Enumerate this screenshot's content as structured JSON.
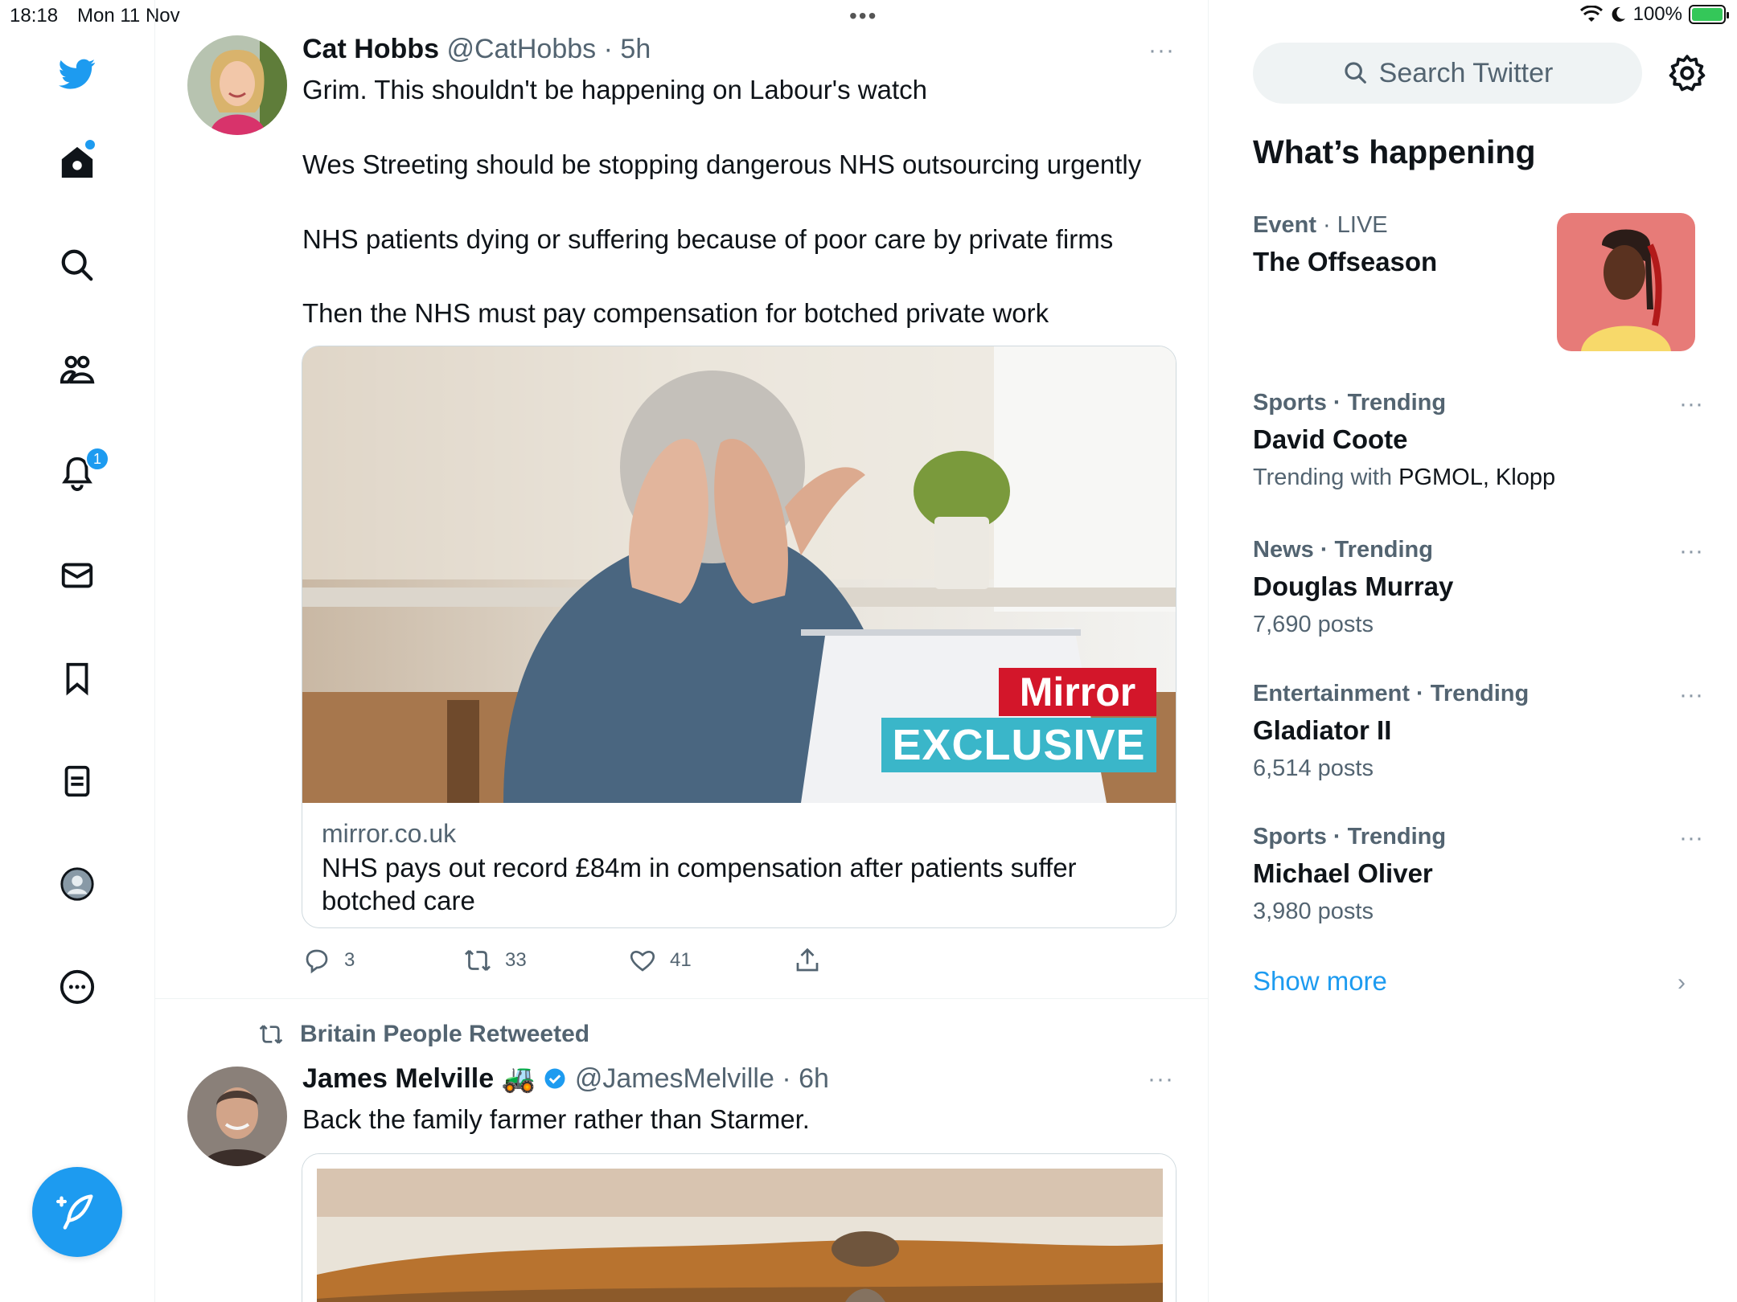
{
  "status_bar": {
    "time": "18:18",
    "date": "Mon 11 Nov",
    "battery": "100%"
  },
  "sidebar": {
    "notifications_badge": "1",
    "items": [
      "twitter-logo",
      "home",
      "explore",
      "communities",
      "notifications",
      "messages",
      "bookmarks",
      "lists",
      "profile",
      "more"
    ]
  },
  "tweet1": {
    "name": "Cat Hobbs",
    "handle": "@CatHobbs",
    "sep": "·",
    "time": "5h",
    "more": "···",
    "lines": [
      "Grim. This shouldn't be happening on Labour's watch",
      "Wes Streeting should be stopping dangerous NHS outsourcing urgently",
      "NHS patients dying or suffering because of poor care by private firms",
      "Then the NHS must pay compensation for botched private work"
    ],
    "card": {
      "badge_top": "Mirror",
      "badge_bottom": "EXCLUSIVE",
      "domain": "mirror.co.uk",
      "title": "NHS pays out record £84m in compensation after patients suffer botched care"
    },
    "replies": "3",
    "retweets": "33",
    "likes": "41"
  },
  "tweet2": {
    "retweeted_by": "Britain People Retweeted",
    "name": "James Melville",
    "emoji": "🚜",
    "handle": "@JamesMelville",
    "sep": "·",
    "time": "6h",
    "more": "···",
    "text": "Back the family farmer rather than Starmer."
  },
  "right": {
    "search_placeholder": "Search Twitter",
    "section_title": "What’s happening",
    "trends": [
      {
        "category": "Event",
        "status": "LIVE",
        "title": "The Offseason",
        "sub": ""
      },
      {
        "category": "Sports",
        "status": "Trending",
        "title": "David Coote",
        "sub_prefix": "Trending with",
        "sub": "PGMOL, Klopp"
      },
      {
        "category": "News",
        "status": "Trending",
        "title": "Douglas Murray",
        "sub": "7,690 posts"
      },
      {
        "category": "Entertainment",
        "status": "Trending",
        "title": "Gladiator II",
        "sub": "6,514 posts"
      },
      {
        "category": "Sports",
        "status": "Trending",
        "title": "Michael Oliver",
        "sub": "3,980 posts"
      }
    ],
    "trend_more": "···",
    "show_more": "Show more",
    "chevron": "›"
  },
  "colors": {
    "accent": "#1d9bf0",
    "muted": "#536471",
    "mirror_red": "#d3162a",
    "exclusive_teal": "#3ab6c9"
  }
}
